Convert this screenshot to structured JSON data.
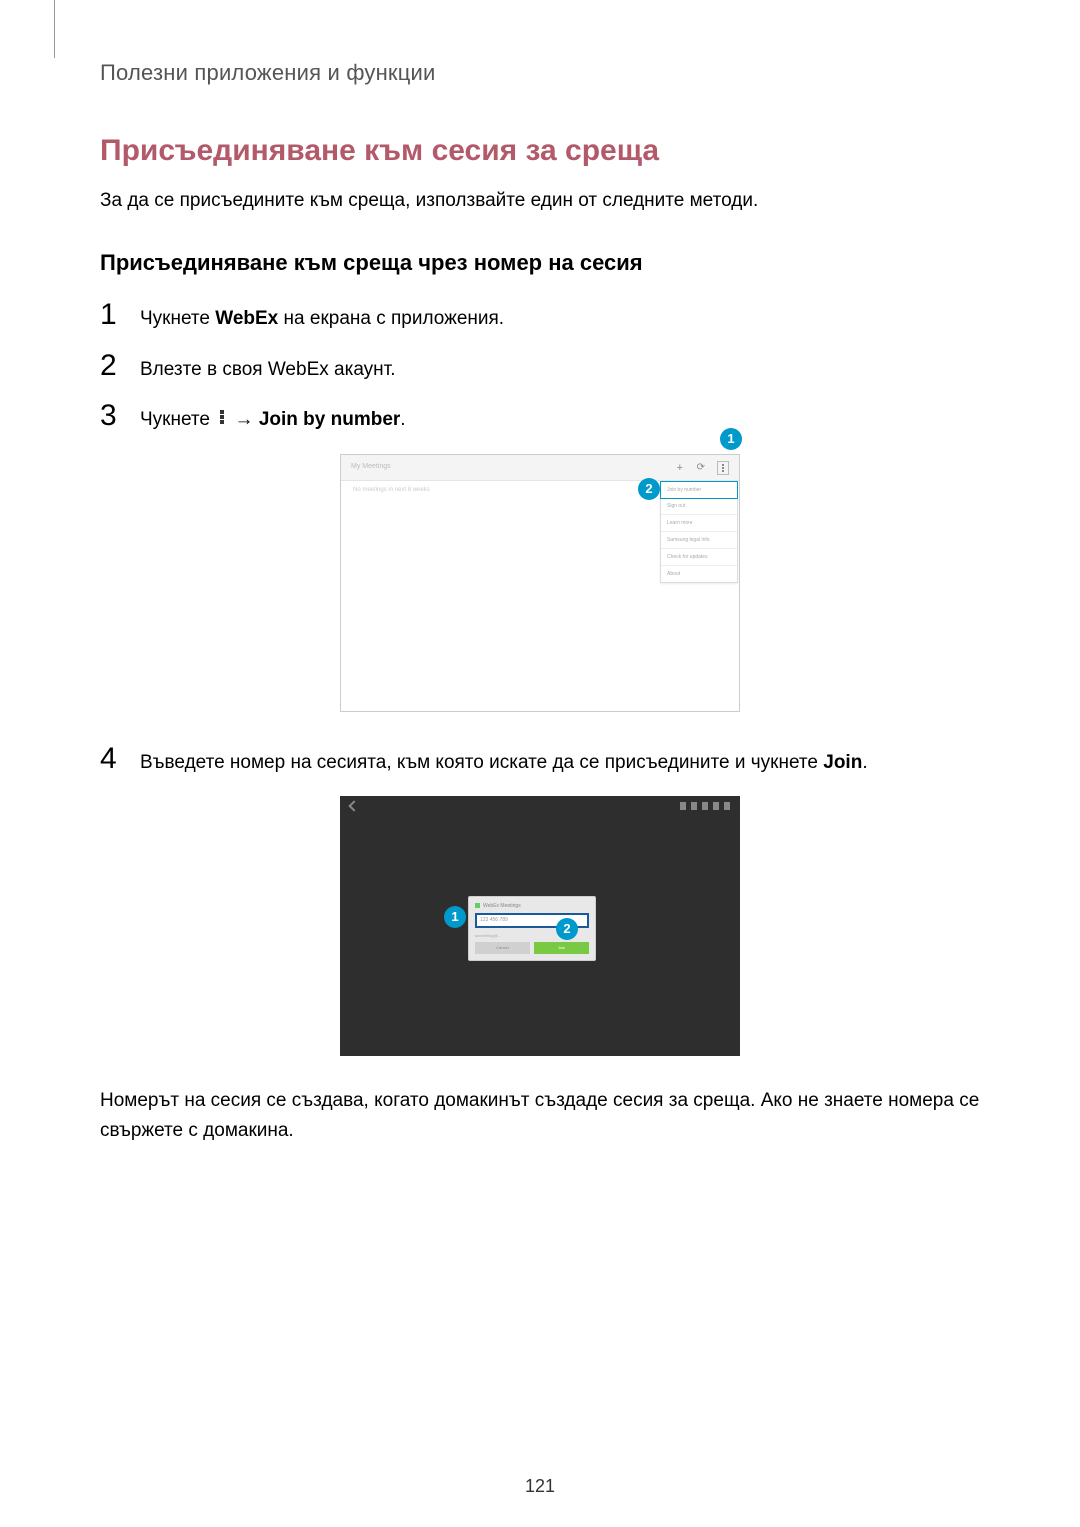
{
  "breadcrumb": "Полезни приложения и функции",
  "title": "Присъединяване към сесия за среща",
  "intro": "За да се присъедините към среща, използвайте един от следните методи.",
  "subtitle": "Присъединяване към среща чрез номер на сесия",
  "steps": {
    "s1_pre": "Чукнете ",
    "s1_bold": "WebEx",
    "s1_post": " на екрана с приложения.",
    "s2": "Влезте в своя WebEx акаунт.",
    "s3_pre": "Чукнете ",
    "s3_arrow": " → ",
    "s3_bold": "Join by number",
    "s3_post": ".",
    "s4_pre": "Въведете номер на сесията, към която искате да се присъедините и чукнете ",
    "s4_bold": "Join",
    "s4_post": "."
  },
  "step_numbers": {
    "n1": "1",
    "n2": "2",
    "n3": "3",
    "n4": "4"
  },
  "callouts": {
    "c1": "1",
    "c2": "2"
  },
  "shot1": {
    "title": "My Meetings",
    "subtext": "No meetings in next 8 weeks",
    "menu": [
      "Join by number",
      "Sign out",
      "Learn more",
      "Samsung legal info",
      "Check for updates",
      "About"
    ]
  },
  "shot2": {
    "dialog_title": "WebEx Meetings",
    "input_placeholder": "123 456 789",
    "subtext": "something@...",
    "cancel": "Cancel",
    "join": "Join"
  },
  "footer": "Номерът на сесия се създава, когато домакинът създаде сесия за среща. Ако не знаете номера се свържете с домакина.",
  "page_number": "121"
}
